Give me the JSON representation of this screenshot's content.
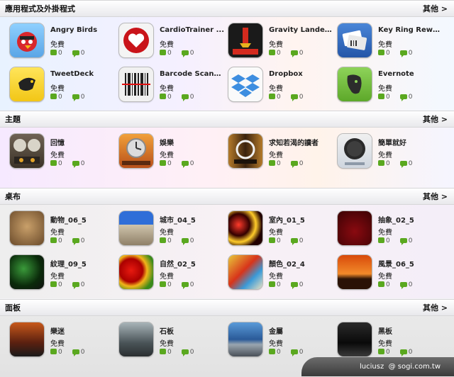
{
  "sections": [
    {
      "title": "應用程式及外掛程式",
      "more": "其他 >",
      "items": [
        {
          "name": "Angry Birds",
          "price": "免費",
          "likes": "0",
          "comments": "0",
          "icon": "angry-birds-icon"
        },
        {
          "name": "CardioTrainer ...",
          "price": "免費",
          "likes": "0",
          "comments": "0",
          "icon": "heart-icon"
        },
        {
          "name": "Gravity Lander ...",
          "price": "免費",
          "likes": "0",
          "comments": "0",
          "icon": "gravity-lander-icon"
        },
        {
          "name": "Key Ring Reward ...",
          "price": "免費",
          "likes": "0",
          "comments": "0",
          "icon": "key-ring-icon"
        },
        {
          "name": "TweetDeck",
          "price": "免費",
          "likes": "0",
          "comments": "0",
          "icon": "tweetdeck-icon"
        },
        {
          "name": "Barcode Scanner ...",
          "price": "免費",
          "likes": "0",
          "comments": "0",
          "icon": "barcode-icon"
        },
        {
          "name": "Dropbox",
          "price": "免費",
          "likes": "0",
          "comments": "0",
          "icon": "dropbox-icon"
        },
        {
          "name": "Evernote",
          "price": "免費",
          "likes": "0",
          "comments": "0",
          "icon": "evernote-icon"
        }
      ]
    },
    {
      "title": "主題",
      "more": "其他 >",
      "items": [
        {
          "name": "回憶",
          "price": "免費",
          "likes": "0",
          "comments": "0",
          "icon": "gauges-icon"
        },
        {
          "name": "娛樂",
          "price": "免費",
          "likes": "0",
          "comments": "0",
          "icon": "clock-icon"
        },
        {
          "name": "求知若渴的讀者",
          "price": "免費",
          "likes": "0",
          "comments": "0",
          "icon": "reader-icon"
        },
        {
          "name": "簡單就好",
          "price": "免費",
          "likes": "0",
          "comments": "0",
          "icon": "simple-icon"
        }
      ]
    },
    {
      "title": "桌布",
      "more": "其他 >",
      "items": [
        {
          "name": "動物_06_5",
          "price": "免費",
          "likes": "0",
          "comments": "0",
          "icon": "animal-wallpaper-icon"
        },
        {
          "name": "城市_04_5",
          "price": "免費",
          "likes": "0",
          "comments": "0",
          "icon": "city-wallpaper-icon"
        },
        {
          "name": "室內_01_5",
          "price": "免費",
          "likes": "0",
          "comments": "0",
          "icon": "interior-wallpaper-icon"
        },
        {
          "name": "抽象_02_5",
          "price": "免費",
          "likes": "0",
          "comments": "0",
          "icon": "abstract-wallpaper-icon"
        },
        {
          "name": "紋理_09_5",
          "price": "免費",
          "likes": "0",
          "comments": "0",
          "icon": "texture-wallpaper-icon"
        },
        {
          "name": "自然_02_5",
          "price": "免費",
          "likes": "0",
          "comments": "0",
          "icon": "nature-wallpaper-icon"
        },
        {
          "name": "顏色_02_4",
          "price": "免費",
          "likes": "0",
          "comments": "0",
          "icon": "color-wallpaper-icon"
        },
        {
          "name": "風景_06_5",
          "price": "免費",
          "likes": "0",
          "comments": "0",
          "icon": "landscape-wallpaper-icon"
        }
      ]
    },
    {
      "title": "面板",
      "more": "其他 >",
      "items": [
        {
          "name": "樂迷",
          "price": "免費",
          "likes": "0",
          "comments": "0",
          "icon": "music-panel-icon"
        },
        {
          "name": "石板",
          "price": "免費",
          "likes": "0",
          "comments": "0",
          "icon": "slate-panel-icon"
        },
        {
          "name": "金屬",
          "price": "免費",
          "likes": "0",
          "comments": "0",
          "icon": "metal-panel-icon"
        },
        {
          "name": "黑板",
          "price": "免費",
          "likes": "0",
          "comments": "0",
          "icon": "black-panel-icon"
        }
      ]
    }
  ],
  "footer": {
    "user": "luciusz",
    "site": "@ sogi.com.tw"
  },
  "colors": {
    "accent_green": "#5aa81f",
    "footer_bg": "#4a4a4a"
  }
}
